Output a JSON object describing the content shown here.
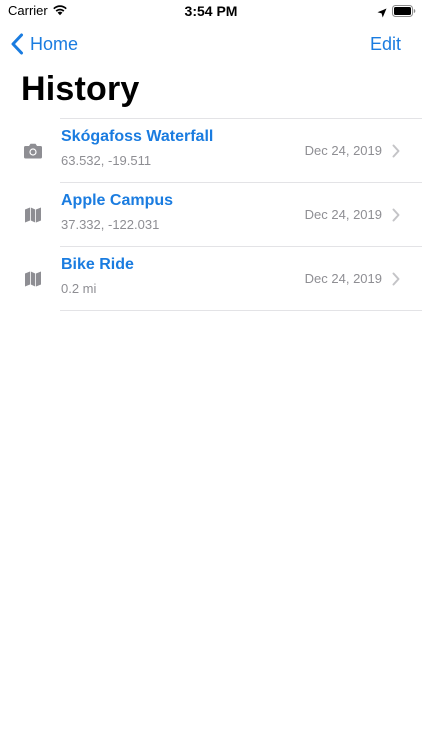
{
  "status_bar": {
    "carrier": "Carrier",
    "time": "3:54 PM",
    "icons": [
      "wifi-icon",
      "location-icon",
      "battery-icon"
    ]
  },
  "nav": {
    "back_label": "Home",
    "back_icon": "chevron-left-icon",
    "edit_label": "Edit"
  },
  "page": {
    "title": "History"
  },
  "items": [
    {
      "icon": "camera-icon",
      "title": "Skógafoss Waterfall",
      "subtitle": "63.532, -19.511",
      "date": "Dec 24, 2019"
    },
    {
      "icon": "map-icon",
      "title": "Apple Campus",
      "subtitle": "37.332, -122.031",
      "date": "Dec 24, 2019"
    },
    {
      "icon": "map-icon",
      "title": "Bike Ride",
      "subtitle": "0.2 mi",
      "date": "Dec 24, 2019"
    }
  ],
  "colors": {
    "accent": "#1a7ce0",
    "secondary_text": "#8e8e93",
    "icon_gray": "#8e8e93",
    "separator": "#e3e3e6"
  }
}
